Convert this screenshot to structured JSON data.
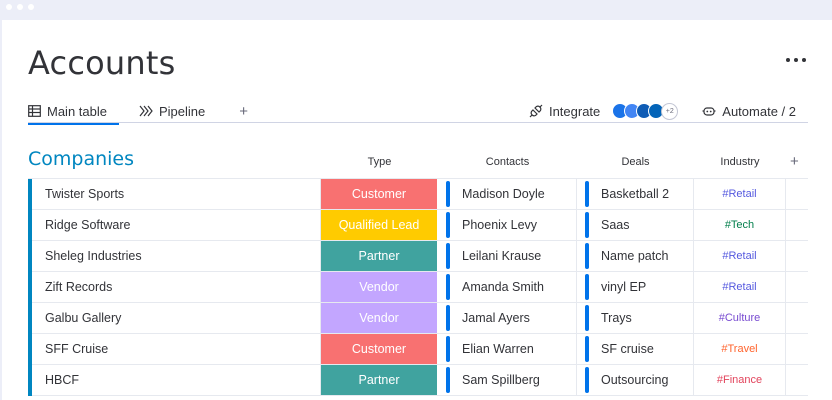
{
  "page": {
    "title": "Accounts",
    "more_label": "..."
  },
  "tabs": [
    {
      "label": "Main table",
      "icon": "table-icon",
      "active": true
    },
    {
      "label": "Pipeline",
      "icon": "pipeline-icon",
      "active": false
    }
  ],
  "tab_add_label": "+",
  "toolbar": {
    "integrate_label": "Integrate",
    "apps_more_count": "+2",
    "automate_label": "Automate / 2"
  },
  "group": {
    "title": "Companies",
    "color": "#0086c0"
  },
  "columns": {
    "type": "Type",
    "contacts": "Contacts",
    "deals": "Deals",
    "industry": "Industry",
    "add": "+"
  },
  "type_colors": {
    "Customer": "#f87171",
    "Qualified Lead": "#ffcb00",
    "Partner": "#40a39f",
    "Vendor": "#c3a6ff"
  },
  "rows": [
    {
      "name": "Twister Sports",
      "type": "Customer",
      "contact": "Madison Doyle",
      "deal": "Basketball 2",
      "industry": "#Retail",
      "industry_color": "#5559df"
    },
    {
      "name": "Ridge Software",
      "type": "Qualified Lead",
      "contact": "Phoenix Levy",
      "deal": "Saas",
      "industry": "#Tech",
      "industry_color": "#037f4c"
    },
    {
      "name": "Sheleg Industries",
      "type": "Partner",
      "contact": "Leilani Krause",
      "deal": "Name patch",
      "industry": "#Retail",
      "industry_color": "#5559df"
    },
    {
      "name": "Zift Records",
      "type": "Vendor",
      "contact": "Amanda Smith",
      "deal": "vinyl EP",
      "industry": "#Retail",
      "industry_color": "#5559df"
    },
    {
      "name": "Galbu Gallery",
      "type": "Vendor",
      "contact": "Jamal Ayers",
      "deal": "Trays",
      "industry": "#Culture",
      "industry_color": "#784bd1"
    },
    {
      "name": "SFF Cruise",
      "type": "Customer",
      "contact": "Elian Warren",
      "deal": "SF cruise",
      "industry": "#Travel",
      "industry_color": "#ff642e"
    },
    {
      "name": "HBCF",
      "type": "Partner",
      "contact": "Sam Spillberg",
      "deal": "Outsourcing",
      "industry": "#Finance",
      "industry_color": "#e2445c"
    }
  ]
}
